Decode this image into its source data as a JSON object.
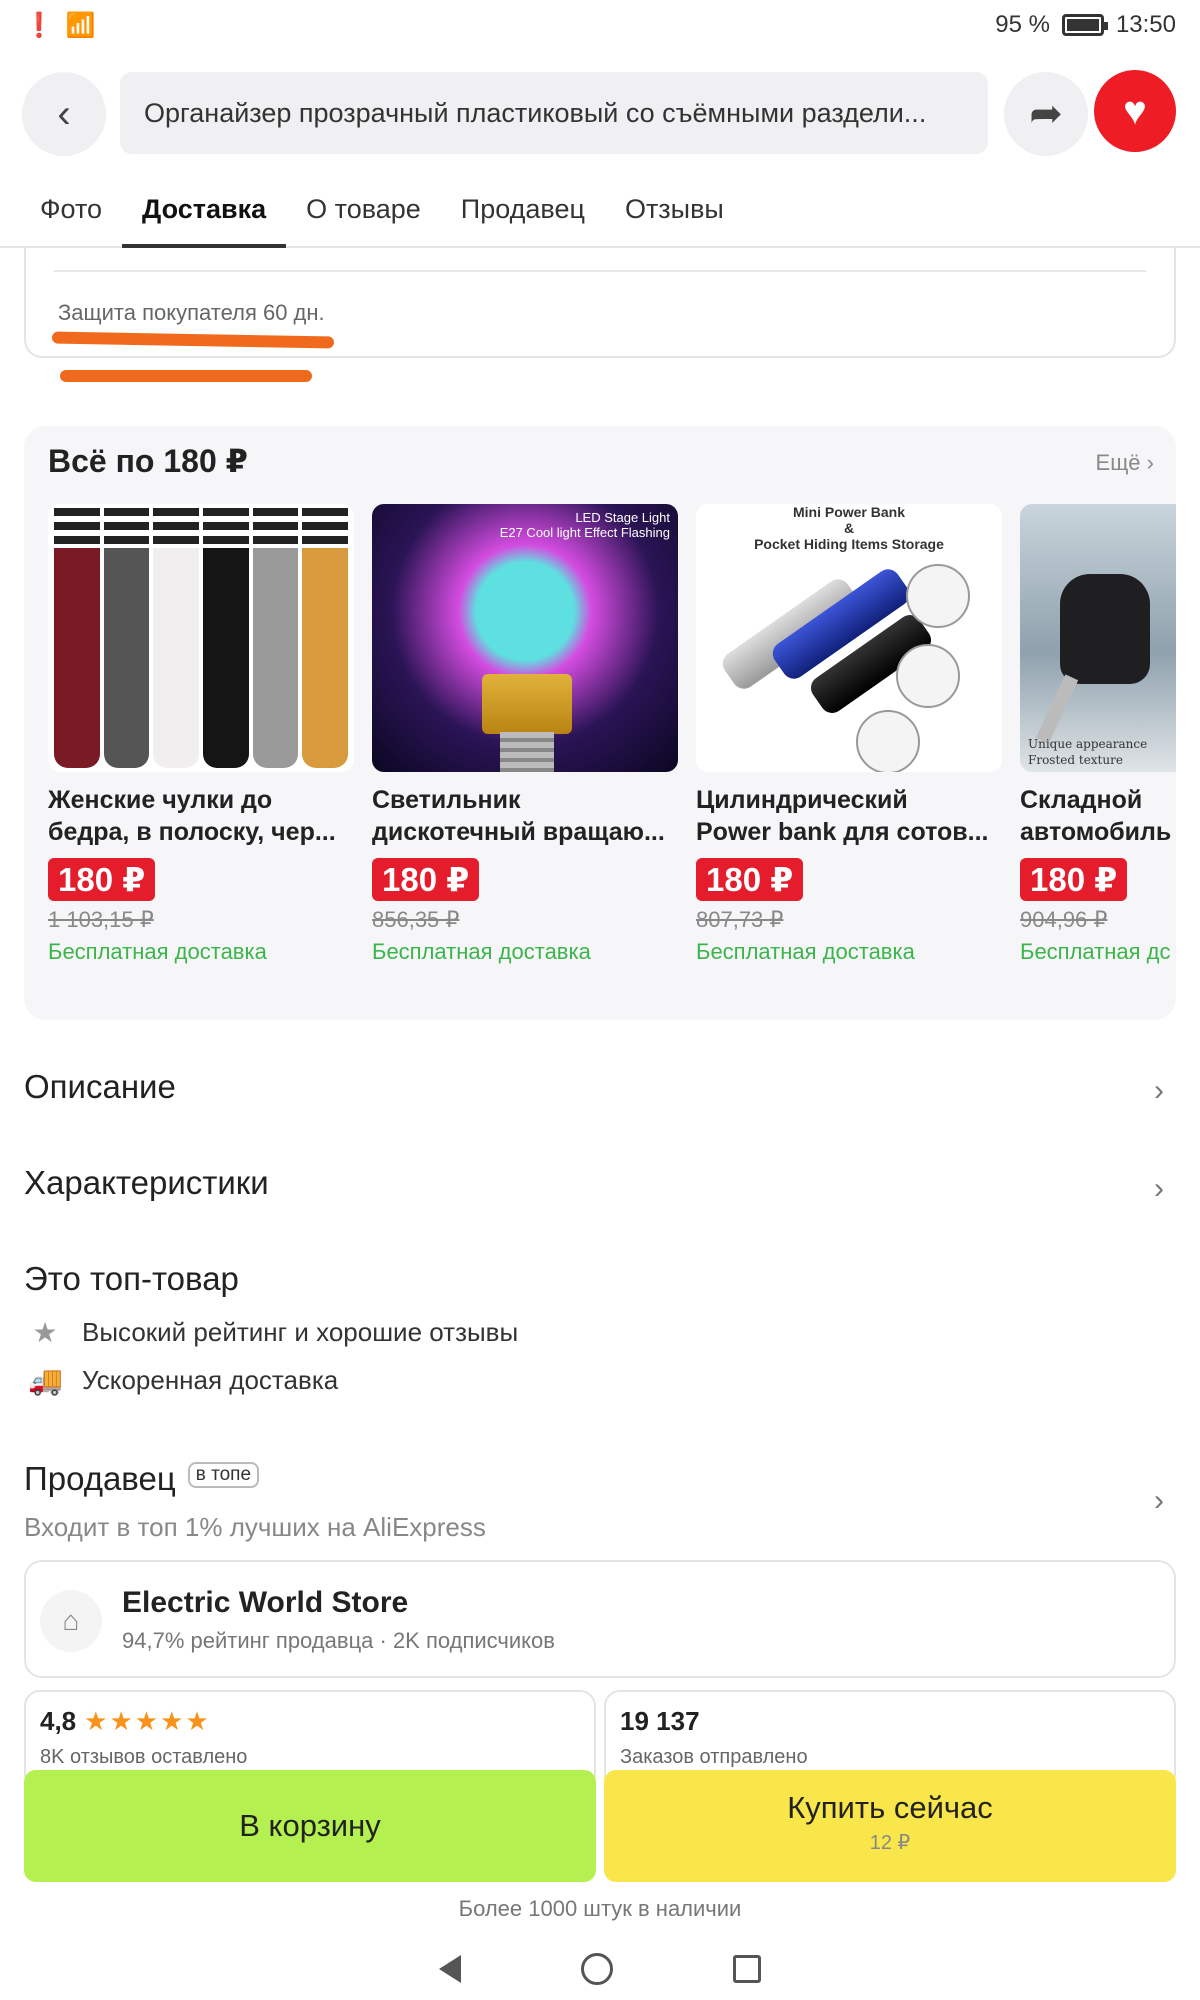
{
  "status_bar": {
    "battery": "95 %",
    "time": "13:50"
  },
  "header": {
    "search_text": "Органайзер прозрачный пластиковый со съёмными раздели...",
    "back_icon": "chevron-left-icon",
    "share_icon": "share-arrow-icon",
    "favorite_icon": "heart-icon"
  },
  "tabs": [
    {
      "label": "Фото"
    },
    {
      "label": "Доставка",
      "active": true
    },
    {
      "label": "О товаре"
    },
    {
      "label": "Продавец"
    },
    {
      "label": "Отзывы"
    }
  ],
  "protection": {
    "text": "Защита покупателя 60 дн."
  },
  "promo": {
    "title": "Всё по 180 ₽",
    "more": "Ещё",
    "products": [
      {
        "name1": "Женские чулки до",
        "name2": "бедра, в полоску, чер...",
        "price": "180 ₽",
        "old_price": "1 103,15 ₽",
        "shipping": "Бесплатная доставка"
      },
      {
        "name1": "Светильник",
        "name2": "дискотечный вращаю...",
        "price": "180 ₽",
        "old_price": "856,35 ₽",
        "shipping": "Бесплатная доставка",
        "image_caption_1": "LED Stage Light",
        "image_caption_2": "E27 Cool light Effect Flashing"
      },
      {
        "name1": "Цилиндрический",
        "name2": "Power bank для сотов...",
        "price": "180 ₽",
        "old_price": "807,73 ₽",
        "shipping": "Бесплатная доставка",
        "image_caption_1": "Mini Power Bank",
        "image_caption_2": "&",
        "image_caption_3": "Pocket Hiding Items Storage"
      },
      {
        "name1": "Складной",
        "name2": "автомобиль",
        "price": "180 ₽",
        "old_price": "904,96 ₽",
        "shipping": "Бесплатная дс",
        "image_caption_1": "Unique appearance",
        "image_caption_2": "Frosted texture"
      }
    ]
  },
  "sections": {
    "description": "Описание",
    "characteristics": "Характеристики",
    "top_title": "Это топ-товар",
    "top_features": [
      {
        "icon": "star-icon",
        "text": "Высокий рейтинг и хорошие отзывы"
      },
      {
        "icon": "truck-icon",
        "text": "Ускоренная доставка"
      }
    ],
    "seller_title": "Продавец",
    "seller_badge": "в топе",
    "seller_sub": "Входит в топ 1% лучших на AliExpress"
  },
  "store": {
    "name": "Electric World Store",
    "stats": "94,7% рейтинг продавца · 2K подписчиков"
  },
  "ratings": {
    "score": "4,8",
    "reviews": "8K отзывов оставлено",
    "orders": "19 137",
    "orders_label": "Заказов отправлено"
  },
  "actions": {
    "cart": "В корзину",
    "buy": "Купить сейчас",
    "buy_sub": "12 ₽",
    "stock": "Более 1000 штук в наличии"
  },
  "colors": {
    "accent_red": "#ee1c25",
    "cart_green": "#b4f04f",
    "buy_yellow": "#f8e64a",
    "shipping_green": "#3bb54a"
  }
}
